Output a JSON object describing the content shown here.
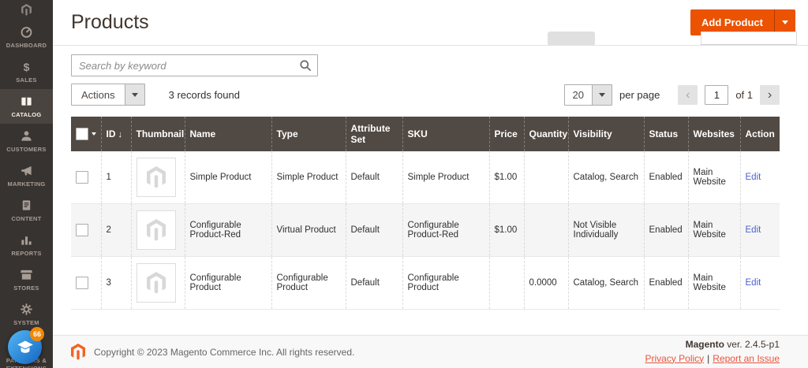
{
  "sidebar": {
    "items": [
      {
        "label": "DASHBOARD"
      },
      {
        "label": "SALES"
      },
      {
        "label": "CATALOG"
      },
      {
        "label": "CUSTOMERS"
      },
      {
        "label": "MARKETING"
      },
      {
        "label": "CONTENT"
      },
      {
        "label": "REPORTS"
      },
      {
        "label": "STORES"
      },
      {
        "label": "SYSTEM"
      },
      {
        "label": "FIND PARTNERS & EXTENSIONS"
      }
    ],
    "chat_badge": "66"
  },
  "header": {
    "title": "Products",
    "add_product": "Add Product"
  },
  "toolbar": {
    "search_placeholder": "Search by keyword",
    "actions": "Actions",
    "records": "3 records found",
    "per_page_value": "20",
    "per_page_label": "per page",
    "page_value": "1",
    "of_label": "of 1"
  },
  "icons": {
    "sales_glyph": "$",
    "prev": "‹",
    "next": "›",
    "sort_desc": "↓"
  },
  "table": {
    "headers": {
      "id": "ID",
      "thumbnail": "Thumbnail",
      "name": "Name",
      "type": "Type",
      "attribute_set": "Attribute Set",
      "sku": "SKU",
      "price": "Price",
      "quantity": "Quantity",
      "visibility": "Visibility",
      "status": "Status",
      "websites": "Websites",
      "action": "Action"
    },
    "rows": [
      {
        "id": "1",
        "name": "Simple Product",
        "type": "Simple Product",
        "attribute_set": "Default",
        "sku": "Simple Product",
        "price": "$1.00",
        "quantity": "",
        "visibility": "Catalog, Search",
        "status": "Enabled",
        "websites": "Main Website",
        "action": "Edit"
      },
      {
        "id": "2",
        "name": "Configurable Product-Red",
        "type": "Virtual Product",
        "attribute_set": "Default",
        "sku": "Configurable Product-Red",
        "price": "$1.00",
        "quantity": "",
        "visibility": "Not Visible Individually",
        "status": "Enabled",
        "websites": "Main Website",
        "action": "Edit"
      },
      {
        "id": "3",
        "name": "Configurable Product",
        "type": "Configurable Product",
        "attribute_set": "Default",
        "sku": "Configurable Product",
        "price": "",
        "quantity": "0.0000",
        "visibility": "Catalog, Search",
        "status": "Enabled",
        "websites": "Main Website",
        "action": "Edit"
      }
    ]
  },
  "footer": {
    "copyright": "Copyright © 2023 Magento Commerce Inc. All rights reserved.",
    "brand": "Magento",
    "version": " ver. 2.4.5-p1",
    "privacy": "Privacy Policy",
    "separator": "|",
    "report": "Report an Issue"
  },
  "colors": {
    "accent": "#eb5202",
    "sidebar_bg": "#373330",
    "sidebar_active_bg": "#4a4440",
    "table_header_bg": "#514943",
    "edit_link": "#4a5fd1",
    "footer_link": "#e8553e",
    "chat_badge_bg": "#f18805"
  }
}
